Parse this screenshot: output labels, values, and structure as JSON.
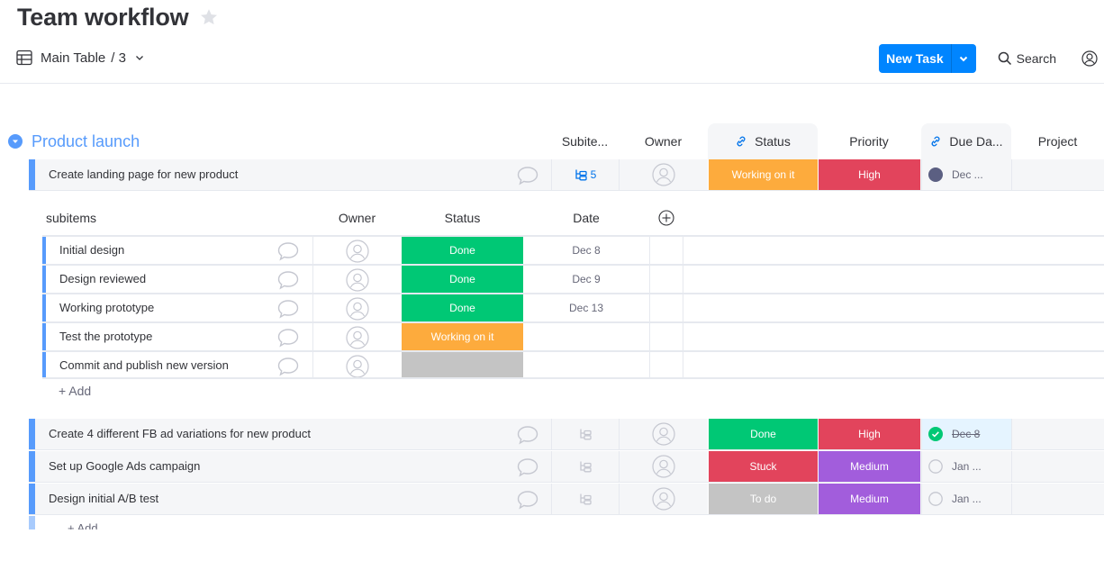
{
  "board": {
    "title": "Team workflow",
    "favorite_icon": "star-icon"
  },
  "view": {
    "icon": "table-icon",
    "label": "Main Table",
    "count": "/ 3",
    "dropdown_icon": "chevron-down-icon"
  },
  "toolbar": {
    "new_task_label": "New Task",
    "new_task_dropdown_icon": "chevron-down-icon",
    "search_label": "Search",
    "search_icon": "search-icon",
    "person_icon": "person-circle-icon"
  },
  "colors": {
    "accent": "#0085ff",
    "group": "#579bfc",
    "done": "#00c875",
    "working": "#fdab3d",
    "stuck": "#e2445c",
    "high": "#e2445c",
    "medium": "#a25ddc",
    "todo": "#c4c4c4",
    "empty": "#c4c4c4"
  },
  "group": {
    "name": "Product launch",
    "columns": {
      "subitems": "Subite...",
      "owner": "Owner",
      "status": "Status",
      "priority": "Priority",
      "due_date": "Due Da...",
      "project": "Project"
    },
    "items": [
      {
        "name": "Create landing page for new product",
        "subitems_count": "5",
        "status": "Working on it",
        "status_color": "#fdab3d",
        "priority": "High",
        "priority_color": "#e2445c",
        "due_date": "Dec ...",
        "due_state": "overdue"
      },
      {
        "name": "Create 4 different FB ad variations for new product",
        "subitems_count": "",
        "status": "Done",
        "status_color": "#00c875",
        "priority": "High",
        "priority_color": "#e2445c",
        "due_date": "Dec 8",
        "due_state": "done"
      },
      {
        "name": "Set up Google Ads campaign",
        "subitems_count": "",
        "status": "Stuck",
        "status_color": "#e2445c",
        "priority": "Medium",
        "priority_color": "#a25ddc",
        "due_date": "Jan ...",
        "due_state": "pending"
      },
      {
        "name": "Design initial A/B test",
        "subitems_count": "",
        "status": "To do",
        "status_color": "#c4c4c4",
        "priority": "Medium",
        "priority_color": "#a25ddc",
        "due_date": "Jan ...",
        "due_state": "pending"
      }
    ],
    "add_item_label": "+ Add"
  },
  "subitems": {
    "columns": {
      "name": "subitems",
      "owner": "Owner",
      "status": "Status",
      "date": "Date"
    },
    "add_column_icon": "plus-circle-icon",
    "rows": [
      {
        "name": "Initial design",
        "status": "Done",
        "status_color": "#00c875",
        "date": "Dec 8"
      },
      {
        "name": "Design reviewed",
        "status": "Done",
        "status_color": "#00c875",
        "date": "Dec 9"
      },
      {
        "name": "Working prototype",
        "status": "Done",
        "status_color": "#00c875",
        "date": "Dec 13"
      },
      {
        "name": "Test the prototype",
        "status": "Working on it",
        "status_color": "#fdab3d",
        "date": ""
      },
      {
        "name": "Commit and publish new version",
        "status": "",
        "status_color": "#c4c4c4",
        "date": ""
      }
    ],
    "add_label": "+ Add"
  }
}
